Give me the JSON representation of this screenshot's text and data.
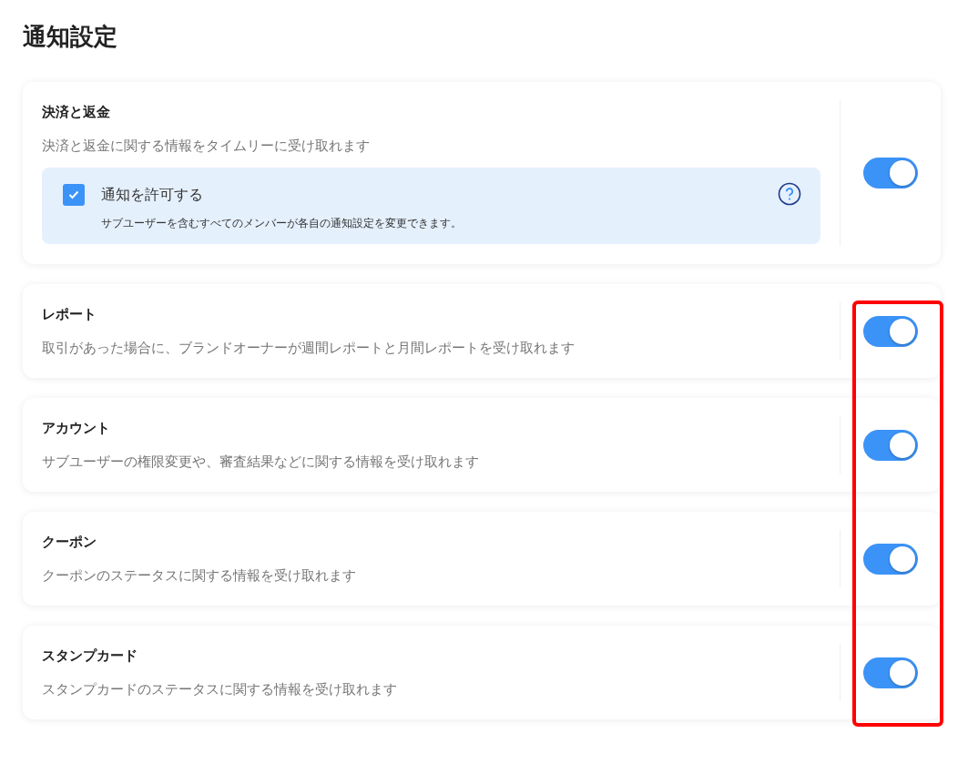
{
  "title": "通知設定",
  "sections": [
    {
      "title": "決済と返金",
      "description": "決済と返金に関する情報をタイムリーに受け取れます",
      "on": true,
      "notice": {
        "label": "通知を許可する",
        "checked": true,
        "note": "サブユーザーを含むすべてのメンバーが各自の通知設定を変更できます。"
      }
    },
    {
      "title": "レポート",
      "description": "取引があった場合に、ブランドオーナーが週間レポートと月間レポートを受け取れます",
      "on": true
    },
    {
      "title": "アカウント",
      "description": "サブユーザーの権限変更や、審査結果などに関する情報を受け取れます",
      "on": true
    },
    {
      "title": "クーポン",
      "description": "クーポンのステータスに関する情報を受け取れます",
      "on": true
    },
    {
      "title": "スタンプカード",
      "description": "スタンプカードのステータスに関する情報を受け取れます",
      "on": true
    }
  ],
  "highlight": {
    "visible": true
  }
}
